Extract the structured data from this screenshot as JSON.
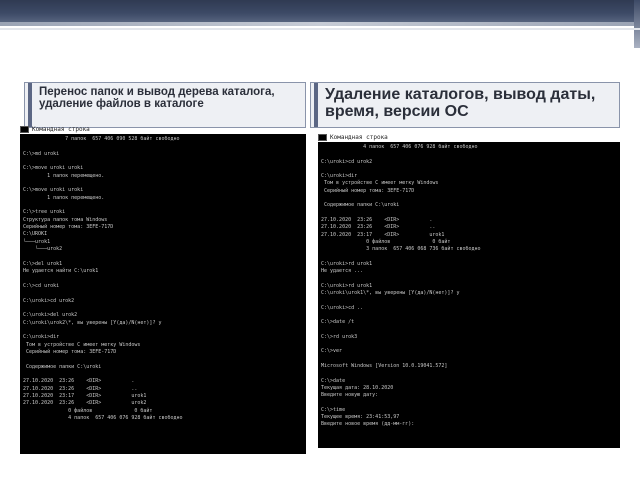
{
  "left_tab": {
    "title": "Перенос папок и вывод дерева каталога, удаление файлов в каталоге"
  },
  "right_tab": {
    "title": "Удаление каталогов, вывод даты, время, версии ОС"
  },
  "left_console": {
    "window_title": "Командная строка",
    "text": "              7 папок  657 406 090 528 байт свободно\n\nC:\\>md uroki\n\nC:\\>move uroki uroki\n        1 папок перемещено.\n\nC:\\>move uroki uroki\n        1 папок перемещено.\n\nC:\\>tree uroki\nСтруктура папок тома Windows\nСерийный номер тома: 3EFE-717D\nC:\\UROKI\n└───urok1\n    └───urok2\n\nC:\\>del urok1\nНе удается найти C:\\urok1\n\nC:\\>cd uroki\n\nC:\\uroki>cd urok2\n\nC:\\uroki>del urok2\nC:\\uroki\\urok2\\*, вы уверены [Y(да)/N(нет)]? y\n\nC:\\uroki>dir\n Том в устройстве C имеет метку Windows\n Серийный номер тома: 3EFE-717D\n\n Содержимое папки C:\\uroki\n\n27.10.2020  23:26    <DIR>          .\n27.10.2020  23:26    <DIR>          ..\n27.10.2020  23:17    <DIR>          urok1\n27.10.2020  23:26    <DIR>          urok2\n               0 файлов              0 байт\n               4 папок  657 406 076 928 байт свободно"
  },
  "right_console": {
    "window_title": "Командная строка",
    "text": "              4 папок  657 406 076 928 байт свободно\n\nC:\\uroki>cd urok2\n\nC:\\uroki>dir\n Том в устройстве C имеет метку Windows\n Серийный номер тома: 3EFE-717D\n\n Содержимое папки C:\\uroki\n\n27.10.2020  23:26    <DIR>          .\n27.10.2020  23:26    <DIR>          ..\n27.10.2020  23:17    <DIR>          urok1\n               0 файлов              0 байт\n               3 папок  657 406 068 736 байт свободно\n\nC:\\uroki>rd urok1\nНе удается ...\n\nC:\\uroki>rd urok1\nC:\\uroki\\urok1\\*, вы уверены [Y(да)/N(нет)]? y\n\nC:\\uroki>cd ..\n\nC:\\>date /t\n\nC:\\>rd urok3\n\nC:\\>ver\n\nMicrosoft Windows [Version 10.0.19041.572]\n\nC:\\>date\nТекущая дата: 28.10.2020\nВведите новую дату:\n\nC:\\>time\nТекущее время: 23:41:53,97\nВведите новое время (дд-мм-гг):"
  }
}
